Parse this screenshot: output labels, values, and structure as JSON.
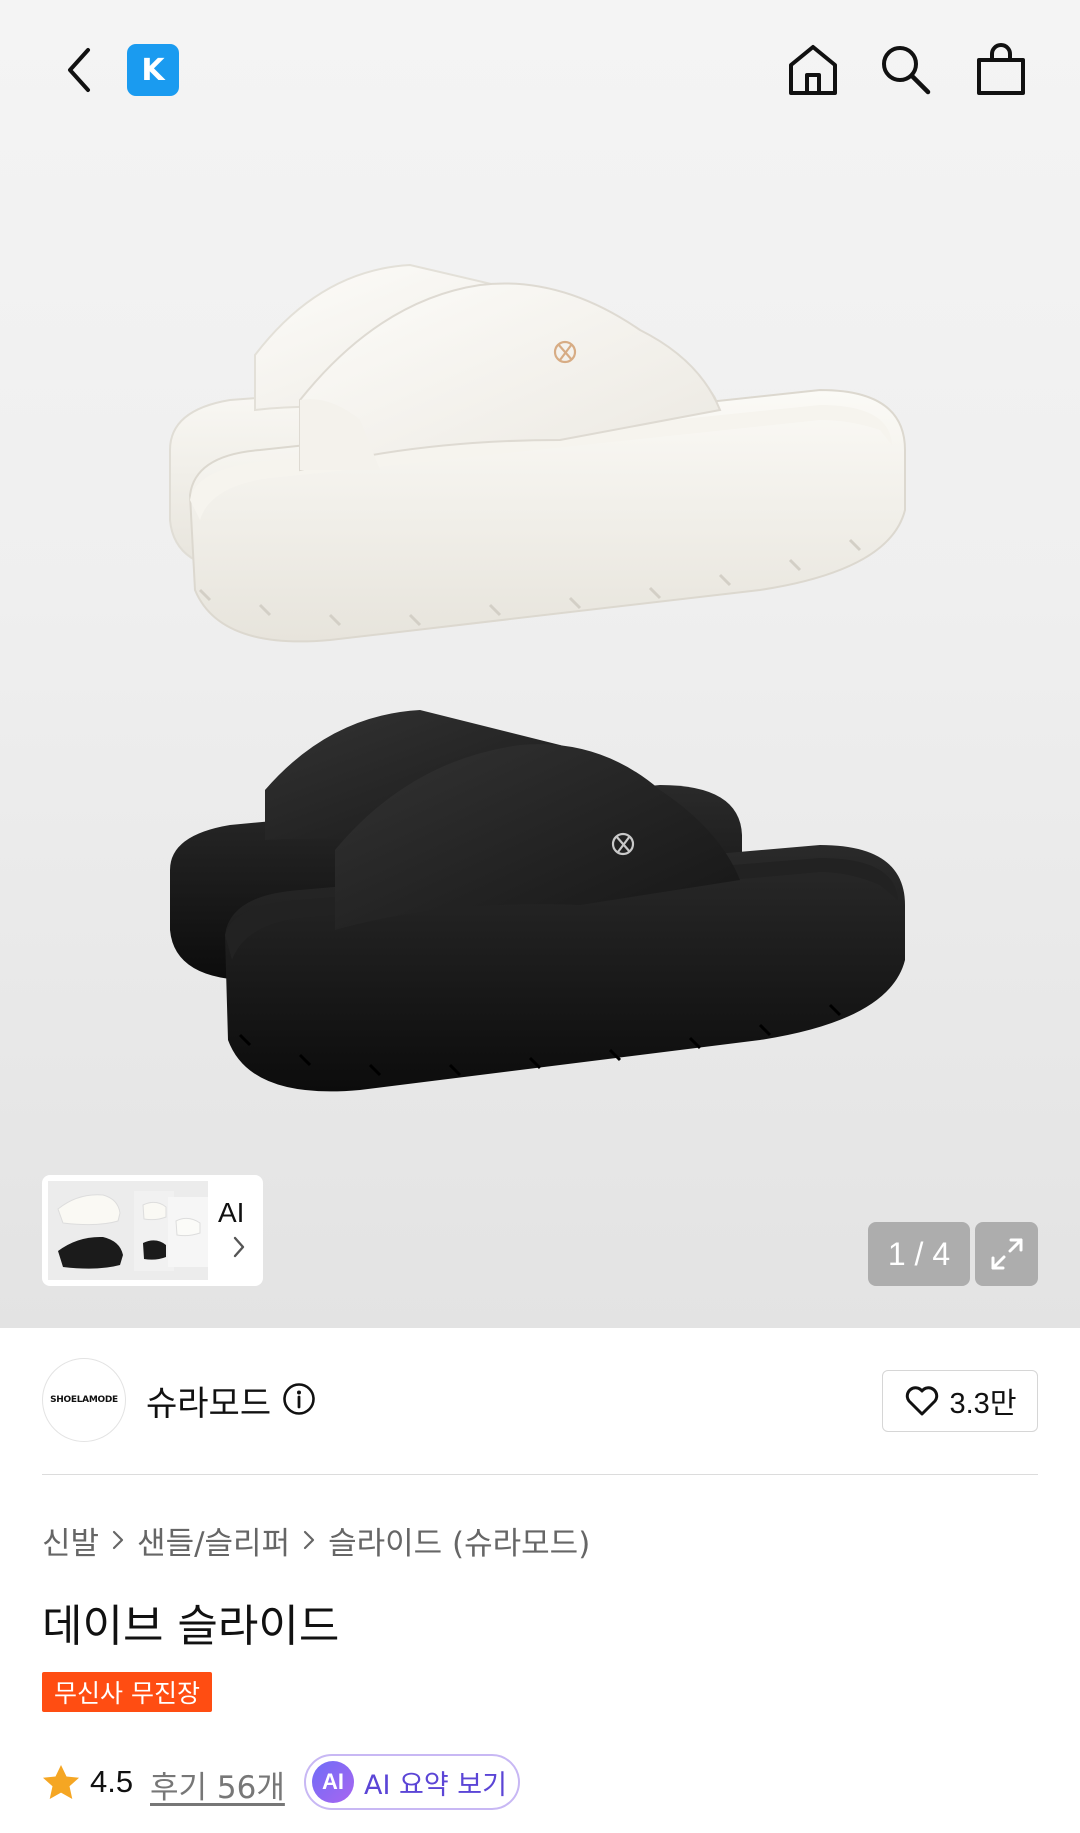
{
  "topbar": {
    "logo_letter": "K"
  },
  "gallery": {
    "counter": "1 / 4",
    "thumb_label": "AI"
  },
  "brand": {
    "logo_text": "SHOELAMODE",
    "name": "슈라모드",
    "likes": "3.3만"
  },
  "breadcrumb": [
    "신발",
    "샌들/슬리퍼",
    "슬라이드 (슈라모드)"
  ],
  "product": {
    "title": "데이브 슬라이드",
    "badge": "무신사 무진장"
  },
  "rating": {
    "score": "4.5",
    "reviews": "후기 56개",
    "ai_icon": "AI",
    "ai_summary": "AI 요약 보기"
  },
  "icons": [
    "back-icon",
    "home-icon",
    "search-icon",
    "shopping-bag-icon",
    "expand-icon",
    "info-icon",
    "heart-icon",
    "chevron-right-icon",
    "star-icon"
  ],
  "colors": {
    "accent_blue": "#1a9bf0",
    "badge_orange": "#ff4d12",
    "star": "#f5a623",
    "ai_purple": "#5b45d6"
  }
}
